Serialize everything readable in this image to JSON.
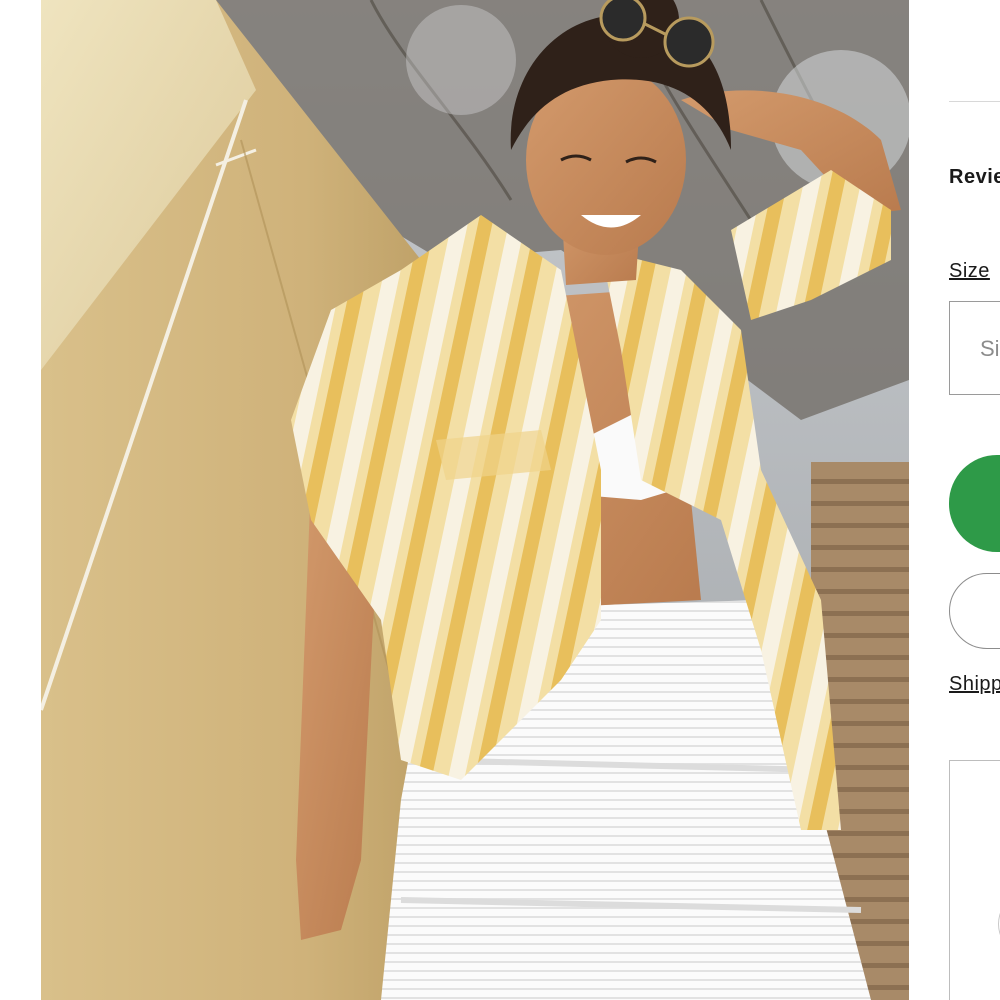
{
  "photo": {
    "alt": "Model wearing yellow striped oversized button-up shirt with white bikini top and white tiered ruffle skirt, posed in front of a canvas tent"
  },
  "product_panel": {
    "reviews_label": "Revie",
    "size_link_label": "Size ",
    "size_select_placeholder": "Si",
    "shipping_link_label": "Shipp"
  },
  "colors": {
    "add_to_bag": "#2e9a48",
    "outline": "#8c8c8c"
  },
  "icons": {
    "favorite_button": "heart-icon"
  }
}
